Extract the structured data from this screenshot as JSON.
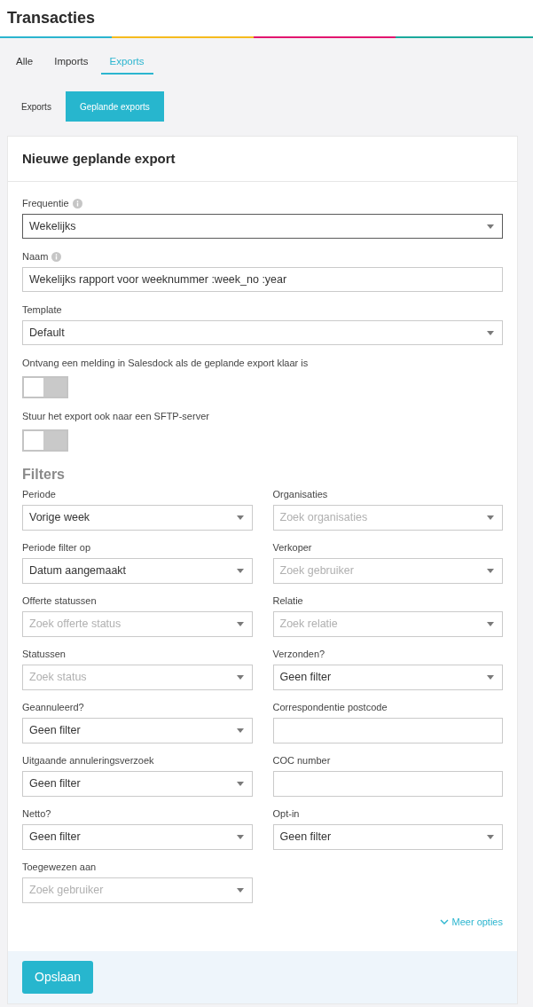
{
  "page": {
    "title": "Transacties"
  },
  "tabs": [
    {
      "label": "Alle",
      "selected": false
    },
    {
      "label": "Imports",
      "selected": false
    },
    {
      "label": "Exports",
      "selected": true
    }
  ],
  "subtabs": [
    {
      "label": "Exports",
      "selected": false
    },
    {
      "label": "Geplande exports",
      "selected": true
    }
  ],
  "form": {
    "title": "Nieuwe geplande export",
    "settings": [
      {
        "kind": "select",
        "label": "Frequentie",
        "info": true,
        "value": "Wekelijks",
        "focused": true
      },
      {
        "kind": "text",
        "label": "Naam",
        "info": true,
        "value": "Wekelijks rapport voor weeknummer :week_no :year",
        "focused": false
      },
      {
        "kind": "select",
        "label": "Template",
        "info": false,
        "value": "Default",
        "focused": false
      },
      {
        "kind": "toggle",
        "label": "Ontvang een melding in Salesdock als de geplande export klaar is",
        "info": false,
        "on": false,
        "focused": false
      },
      {
        "kind": "toggle",
        "label": "Stuur het export ook naar een SFTP-server",
        "info": false,
        "on": false,
        "focused": false
      }
    ],
    "filters": {
      "title": "Filters",
      "fields": [
        {
          "kind": "select",
          "label": "Periode",
          "value": "Vorige week"
        },
        {
          "kind": "select",
          "label": "Organisaties",
          "placeholder": "Zoek organisaties"
        },
        {
          "kind": "select",
          "label": "Periode filter op",
          "value": "Datum aangemaakt"
        },
        {
          "kind": "select",
          "label": "Verkoper",
          "placeholder": "Zoek gebruiker"
        },
        {
          "kind": "select",
          "label": "Offerte statussen",
          "placeholder": "Zoek offerte status"
        },
        {
          "kind": "select",
          "label": "Relatie",
          "placeholder": "Zoek relatie"
        },
        {
          "kind": "select",
          "label": "Statussen",
          "placeholder": "Zoek status"
        },
        {
          "kind": "select",
          "label": "Verzonden?",
          "value": "Geen filter"
        },
        {
          "kind": "select",
          "label": "Geannuleerd?",
          "value": "Geen filter"
        },
        {
          "kind": "text",
          "label": "Correspondentie postcode"
        },
        {
          "kind": "select",
          "label": "Uitgaande annuleringsverzoek",
          "value": "Geen filter"
        },
        {
          "kind": "text",
          "label": "COC number"
        },
        {
          "kind": "select",
          "label": "Netto?",
          "value": "Geen filter"
        },
        {
          "kind": "select",
          "label": "Opt-in",
          "value": "Geen filter"
        },
        {
          "kind": "select",
          "label": "Toegewezen aan",
          "placeholder": "Zoek gebruiker"
        }
      ]
    },
    "more_link": "Meer opties",
    "save_button": "Opslaan"
  }
}
